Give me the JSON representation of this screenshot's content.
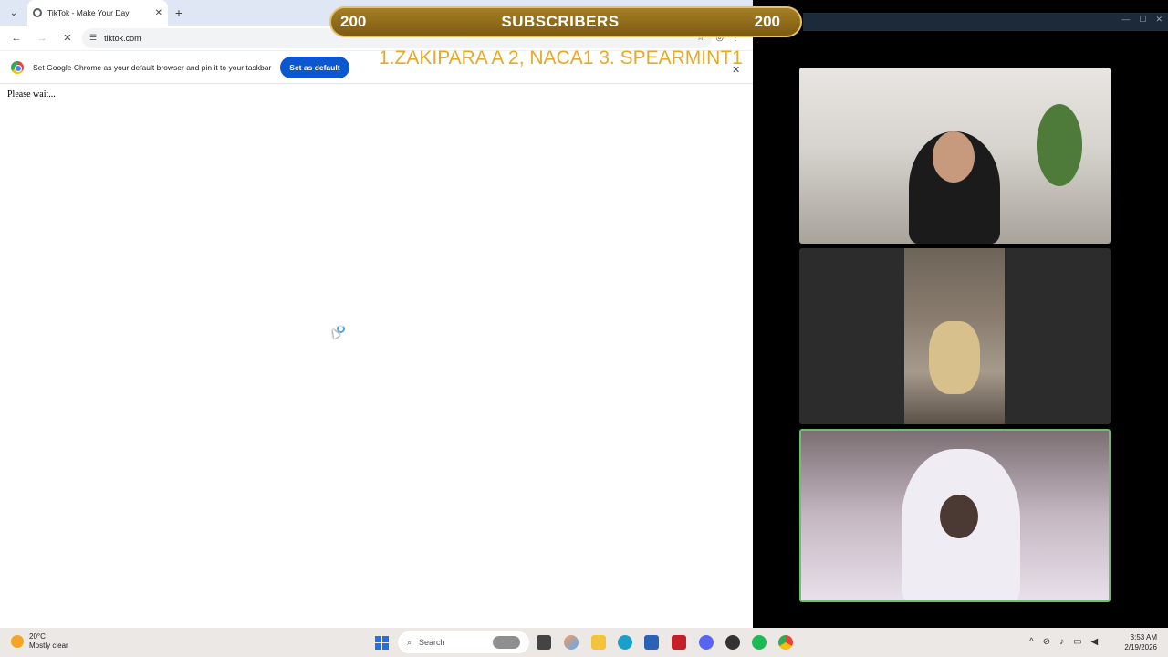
{
  "browser": {
    "tab_title": "TikTok - Make Your Day",
    "url": "tiktok.com",
    "infobar_text": "Set Google Chrome as your default browser and pin it to your taskbar",
    "infobar_button": "Set as default",
    "page_text": "Please wait..."
  },
  "overlay": {
    "left_count": "200",
    "label": "SUBSCRIBERS",
    "right_count": "200",
    "ticker": "1.ZAKIPARA A 2, NACA1  3.  SPEARMINT1"
  },
  "taskbar": {
    "temperature": "20°C",
    "weather": "Mostly clear",
    "search_placeholder": "Search",
    "time": "3:53 AM",
    "date": "2/19/2026"
  },
  "icons": {
    "tab_search": "chevron-down-icon",
    "back": "back-arrow-icon",
    "forward": "forward-arrow-icon",
    "reload": "stop-icon",
    "site_info": "tune-icon",
    "bookmark": "star-icon",
    "profile": "profile-icon",
    "menu": "kebab-menu-icon"
  },
  "colors": {
    "banner_gold": "#a57f24",
    "ticker_gold": "#e6a82b",
    "chrome_blue": "#0b57d0",
    "active_cam_border": "#67c26a"
  }
}
